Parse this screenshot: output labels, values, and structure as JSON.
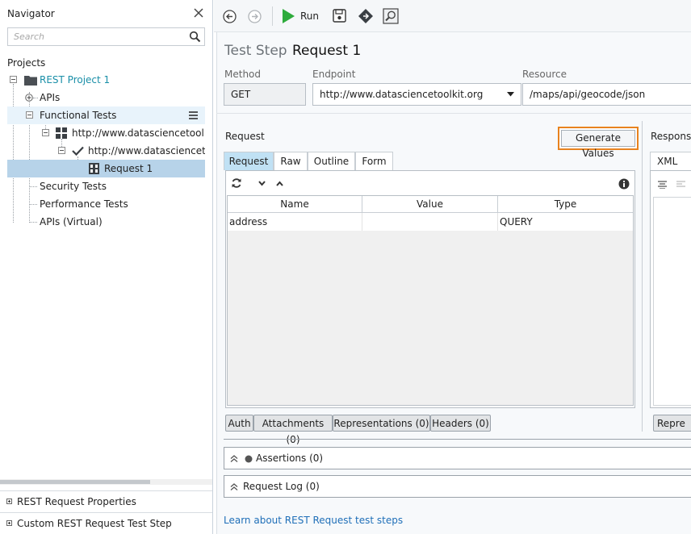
{
  "navigator": {
    "title": "Navigator",
    "search_placeholder": "Search",
    "projects_label": "Projects",
    "tree": [
      {
        "label": "REST Project 1",
        "color": "#1a8fa8"
      },
      {
        "label": "APIs"
      },
      {
        "label": "Functional Tests"
      },
      {
        "label": "http://www.datasciencetoolkit."
      },
      {
        "label": "http://www.datasciencetoo"
      },
      {
        "label": "Request 1"
      },
      {
        "label": "Security Tests"
      },
      {
        "label": "Performance Tests"
      },
      {
        "label": "APIs (Virtual)"
      }
    ],
    "properties": [
      {
        "label": "REST Request Properties"
      },
      {
        "label": "Custom REST Request Test Step Properties"
      }
    ]
  },
  "toolbar": {
    "back_icon": "back-arrow-icon",
    "forward_icon": "forward-arrow-icon",
    "run_label": "Run",
    "run_color": "#2eab3c"
  },
  "editor": {
    "step_kind": "Test Step",
    "step_name": "Request 1",
    "method_label": "Method",
    "method_value": "GET",
    "endpoint_label": "Endpoint",
    "endpoint_value": "http://www.datasciencetoolkit.org",
    "resource_label": "Resource",
    "resource_value": "/maps/api/geocode/json",
    "request_label": "Request",
    "generate_label": "Generate Values",
    "generate_border_color": "#e8821e",
    "tabs": [
      {
        "label": "Request"
      },
      {
        "label": "Raw"
      },
      {
        "label": "Outline"
      },
      {
        "label": "Form"
      }
    ],
    "table": {
      "headers": [
        "Name",
        "Value",
        "Type"
      ],
      "rows": [
        {
          "name": "address",
          "value": "",
          "type": "QUERY"
        }
      ],
      "ellipsis_label": "..."
    },
    "bottom_tabs": [
      {
        "label": "Auth"
      },
      {
        "label": "Attachments (0)"
      },
      {
        "label": "Representations (0)"
      },
      {
        "label": "Headers (0)"
      }
    ],
    "response_label": "Respons",
    "response_tab": "XML",
    "response_bottom_tab": "Repre",
    "assertions_label": "Assertions (0)",
    "request_log_label": "Request Log (0)",
    "learn_link": "Learn about REST Request test steps"
  }
}
